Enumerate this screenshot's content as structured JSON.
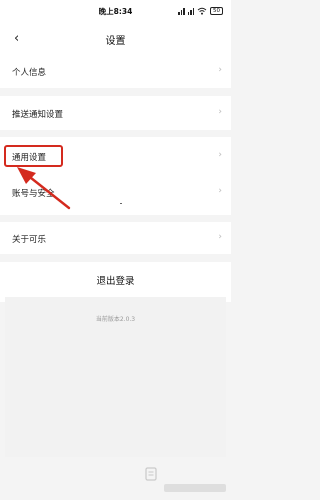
{
  "status_bar": {
    "time": "晚上8:34",
    "battery": "50"
  },
  "nav": {
    "back_glyph": "‹",
    "title": "设置"
  },
  "settings": [
    {
      "label": "个人信息"
    },
    {
      "label": "推送通知设置"
    },
    {
      "label": "通用设置"
    },
    {
      "label": "账号与安全"
    },
    {
      "label": "关于可乐"
    }
  ],
  "chevron": "›",
  "logout": {
    "label": "退出登录"
  },
  "version": {
    "text": "当前版本2.0.3"
  },
  "icons": [
    "signal-icon",
    "wifi-icon",
    "battery-icon",
    "back-arrow-icon",
    "chevron-right-icon",
    "watermark-logo-icon"
  ],
  "colors": {
    "highlight": "#d42a1e",
    "background": "#f4f4f4",
    "row": "#ffffff"
  }
}
